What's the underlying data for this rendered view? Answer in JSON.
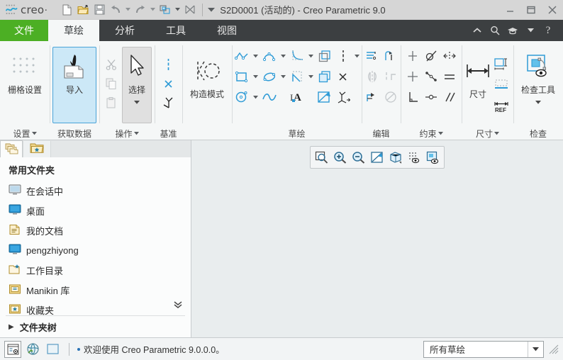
{
  "titlebar": {
    "brand": "creo",
    "brand_dot": "·",
    "window_title": "S2D0001 (活动的) - Creo Parametric 9.0",
    "quick_access": [
      {
        "name": "new-file-button",
        "label": "新建",
        "icon": "new-file-icon",
        "caret": false
      },
      {
        "name": "open-file-button",
        "label": "打开",
        "icon": "open-folder-icon",
        "caret": false
      },
      {
        "name": "save-button",
        "label": "保存",
        "icon": "save-icon",
        "caret": false
      },
      {
        "name": "undo-button",
        "label": "撤消",
        "icon": "undo-icon",
        "caret": true
      },
      {
        "name": "redo-button",
        "label": "重做",
        "icon": "redo-icon",
        "caret": true
      },
      {
        "name": "regenerate-button",
        "label": "重新生成",
        "icon": "regenerate-icon",
        "caret": true
      },
      {
        "name": "close-window-button",
        "label": "关闭",
        "icon": "close-x-icon",
        "caret": false
      }
    ],
    "title_dropdown_icon": "chevron-down-icon",
    "window_controls": [
      {
        "name": "minimize-button",
        "icon": "minimize-icon"
      },
      {
        "name": "maximize-button",
        "icon": "maximize-icon"
      },
      {
        "name": "close-button",
        "icon": "close-icon"
      }
    ]
  },
  "menubar": {
    "file_label": "文件",
    "items": [
      {
        "label": "草绘",
        "active": true
      },
      {
        "label": "分析",
        "active": false
      },
      {
        "label": "工具",
        "active": false
      },
      {
        "label": "视图",
        "active": false
      }
    ],
    "tools": [
      {
        "name": "collapse-ribbon-button",
        "icon": "chevron-up-icon"
      },
      {
        "name": "search-button",
        "icon": "search-icon"
      },
      {
        "name": "learning-button",
        "icon": "graduation-cap-icon"
      },
      {
        "name": "learning-dropdown-button",
        "icon": "chevron-down-icon"
      },
      {
        "name": "help-button",
        "icon": "question-mark-icon"
      }
    ]
  },
  "ribbon": {
    "groups": [
      {
        "name": "setup",
        "label": "设置",
        "has_caret": true,
        "buttons": [
          {
            "name": "grid-settings-button",
            "label": "栅格设置",
            "icon": "grid-dots-icon",
            "selected": false
          }
        ]
      },
      {
        "name": "get-data",
        "label": "获取数据",
        "has_caret": false,
        "buttons": [
          {
            "name": "import-button",
            "label": "导入",
            "icon": "import-icon",
            "selected": true
          }
        ]
      },
      {
        "name": "operations",
        "label": "操作",
        "has_caret": true,
        "small_buttons": [
          {
            "name": "cut-button",
            "icon": "scissors-icon"
          },
          {
            "name": "copy-button",
            "icon": "copy-icon"
          },
          {
            "name": "paste-button",
            "icon": "paste-icon"
          }
        ],
        "buttons": [
          {
            "name": "select-button",
            "label": "选择",
            "icon": "cursor-arrow-icon",
            "selected": false,
            "caret": true
          }
        ]
      },
      {
        "name": "datum",
        "label": "基准",
        "has_caret": false,
        "small_buttons": [
          {
            "name": "centerline-button",
            "icon": "centerline-icon"
          },
          {
            "name": "point-button",
            "icon": "datum-point-icon"
          },
          {
            "name": "coordinate-system-button",
            "icon": "coordinate-system-icon"
          }
        ]
      },
      {
        "name": "construction-mode",
        "label": "",
        "has_caret": false,
        "buttons": [
          {
            "name": "construction-mode-button",
            "label": "构造模式",
            "icon": "construction-mode-icon",
            "selected": false
          }
        ]
      },
      {
        "name": "sketching",
        "label": "草绘",
        "has_caret": false,
        "rows": [
          [
            {
              "name": "line-chain-button",
              "icon": "line-chain-icon",
              "caret": true
            },
            {
              "name": "arc-button",
              "icon": "arc-icon",
              "caret": true
            },
            {
              "name": "fillet-button",
              "icon": "fillet-icon",
              "caret": true
            },
            {
              "name": "offset-button",
              "icon": "offset-icon",
              "caret": false
            },
            {
              "name": "construction-line-button",
              "icon": "dashed-line-icon",
              "caret": true
            }
          ],
          [
            {
              "name": "rectangle-button",
              "icon": "rectangle-icon",
              "caret": true
            },
            {
              "name": "ellipse-button",
              "icon": "ellipse-icon",
              "caret": true
            },
            {
              "name": "chamfer-button",
              "icon": "chamfer-icon",
              "caret": true
            },
            {
              "name": "thicken-button",
              "icon": "thicken-icon",
              "caret": false
            },
            {
              "name": "delete-segment-button",
              "icon": "delete-segment-icon",
              "caret": false
            }
          ],
          [
            {
              "name": "circle-button",
              "icon": "circle-icon",
              "caret": true
            },
            {
              "name": "spline-button",
              "icon": "spline-icon",
              "caret": false
            },
            {
              "name": "text-button",
              "icon": "text-a-icon",
              "caret": false
            },
            {
              "name": "project-button",
              "icon": "project-icon",
              "caret": false
            },
            {
              "name": "coordinate-offset-button",
              "icon": "coord-offset-icon",
              "caret": false
            }
          ]
        ]
      },
      {
        "name": "editing",
        "label": "编辑",
        "has_caret": false,
        "rows": [
          [
            {
              "name": "modify-button",
              "icon": "modify-icon",
              "caret": false
            },
            {
              "name": "corner-trim-button",
              "icon": "corner-trim-icon",
              "caret": false
            }
          ],
          [
            {
              "name": "mirror-button",
              "icon": "mirror-icon",
              "caret": false
            },
            {
              "name": "divide-button",
              "icon": "divide-icon",
              "caret": false
            }
          ],
          [
            {
              "name": "rotate-resize-button",
              "icon": "rotate-resize-icon",
              "caret": false
            },
            {
              "name": "trim-button",
              "icon": "trim-circle-icon",
              "caret": false
            }
          ]
        ]
      },
      {
        "name": "constrain",
        "label": "约束",
        "has_caret": true,
        "rows": [
          [
            {
              "name": "vertical-constraint-button",
              "icon": "vertical-constraint-icon",
              "caret": false
            },
            {
              "name": "tangent-constraint-button",
              "icon": "tangent-constraint-icon",
              "caret": false
            },
            {
              "name": "symmetric-constraint-button",
              "icon": "symmetric-constraint-icon",
              "caret": false
            }
          ],
          [
            {
              "name": "horizontal-constraint-button",
              "icon": "horizontal-constraint-icon",
              "caret": false
            },
            {
              "name": "midpoint-constraint-button",
              "icon": "midpoint-constraint-icon",
              "caret": false
            },
            {
              "name": "equal-constraint-button",
              "icon": "equal-constraint-icon",
              "caret": false
            }
          ],
          [
            {
              "name": "perpendicular-constraint-button",
              "icon": "perpendicular-constraint-icon",
              "caret": false
            },
            {
              "name": "coincident-constraint-button",
              "icon": "coincident-constraint-icon",
              "caret": false
            },
            {
              "name": "parallel-constraint-button",
              "icon": "parallel-constraint-icon",
              "caret": false
            }
          ]
        ]
      },
      {
        "name": "dimension",
        "label": "尺寸",
        "has_caret": true,
        "buttons": [
          {
            "name": "dimension-button",
            "label": "尺寸",
            "icon": "dimension-arrow-icon",
            "selected": false
          }
        ],
        "small_buttons": [
          {
            "name": "perimeter-dimension-button",
            "icon": "perimeter-dimension-icon"
          },
          {
            "name": "baseline-dimension-button",
            "icon": "baseline-dimension-icon"
          },
          {
            "name": "reference-dimension-button",
            "icon": "reference-dimension-icon"
          }
        ]
      },
      {
        "name": "inspect",
        "label": "检查",
        "has_caret": false,
        "buttons": [
          {
            "name": "inspect-tool-button",
            "label": "检查工具",
            "icon": "inspect-tool-icon",
            "selected": false,
            "caret": true
          }
        ]
      }
    ]
  },
  "navigator": {
    "tabs": [
      {
        "name": "model-tree-tab",
        "icon": "stacked-folders-icon",
        "active": true
      },
      {
        "name": "favorites-tab",
        "icon": "favorites-folder-icon",
        "active": false
      }
    ],
    "section_title": "常用文件夹",
    "items": [
      {
        "label": "在会话中",
        "icon": "monitor-session-icon"
      },
      {
        "label": "桌面",
        "icon": "monitor-desktop-icon"
      },
      {
        "label": "我的文档",
        "icon": "documents-icon"
      },
      {
        "label": "pengzhiyong",
        "icon": "monitor-user-icon"
      },
      {
        "label": "工作目录",
        "icon": "working-directory-icon"
      },
      {
        "label": "Manikin 库",
        "icon": "library-folder-icon"
      },
      {
        "label": "收藏夹",
        "icon": "favorites-folder-icon"
      }
    ],
    "expander_icon": "double-chevron-down-icon",
    "folder_tree_label": "文件夹树",
    "folder_tree_arrow": "▶"
  },
  "graphics": {
    "float_toolbar": [
      {
        "name": "zoom-box-button",
        "icon": "zoom-box-icon"
      },
      {
        "name": "zoom-in-button",
        "icon": "zoom-in-icon"
      },
      {
        "name": "zoom-out-button",
        "icon": "zoom-out-icon"
      },
      {
        "name": "refit-button",
        "icon": "refit-icon"
      },
      {
        "name": "display-style-button",
        "icon": "display-style-cube-icon"
      },
      {
        "name": "datum-display-button",
        "icon": "datum-display-icon"
      },
      {
        "name": "annotation-display-button",
        "icon": "annotation-display-icon"
      }
    ]
  },
  "statusbar": {
    "buttons": [
      {
        "name": "model-tree-toggle-button",
        "icon": "model-tree-panel-icon"
      },
      {
        "name": "browser-toggle-button",
        "icon": "globe-browser-icon"
      },
      {
        "name": "graphics-window-toggle-button",
        "icon": "blank-window-icon"
      }
    ],
    "message": "欢迎使用 Creo Parametric 9.0.0.0。",
    "filter_value": "所有草绘",
    "filter_arrow_icon": "chevron-down-icon",
    "resize_grip_icon": "resize-grip-icon"
  },
  "colors": {
    "accent_green": "#4caf24",
    "menubar_dark": "#3c3f41",
    "titlebar_gray": "#d6d6d6",
    "ribbon_bg": "#f5f7f7",
    "selected_blue": "#cce8f7",
    "selected_border": "#4aa3d8",
    "icon_blue": "#2e9bd6",
    "graphics_bg": "#e9edee"
  }
}
